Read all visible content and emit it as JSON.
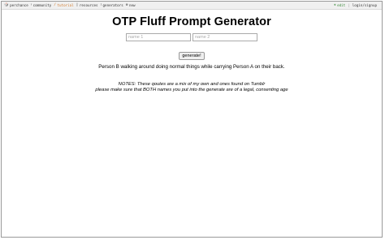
{
  "nav": {
    "items": [
      {
        "label": "perchance",
        "icon": "perchance-logo-icon"
      },
      {
        "label": "community",
        "icon": "community-icon"
      },
      {
        "label": "tutorial",
        "icon": "tutorial-icon"
      },
      {
        "label": "resources",
        "icon": "resources-icon"
      },
      {
        "label": "generators",
        "icon": "generators-icon"
      },
      {
        "label": "new",
        "icon": "new-icon"
      }
    ],
    "edit_label": "edit",
    "login_label": "login/signup"
  },
  "page": {
    "title": "OTP Fluff Prompt Generator",
    "name1_placeholder": "name 1",
    "name2_placeholder": "name 2",
    "generate_label": "generate!",
    "output": "Person B walking around doing normal things while carrying Person A on their back.",
    "notes_line1": "NOTES: These qoutes are a mix of my own and ones found on Tumblr",
    "notes_line2": "please make sure that BOTH names you put into the generate are of a legal, consenting age"
  },
  "colors": {
    "tutorial": "#d27a2c",
    "edit": "#3a8a3a"
  }
}
